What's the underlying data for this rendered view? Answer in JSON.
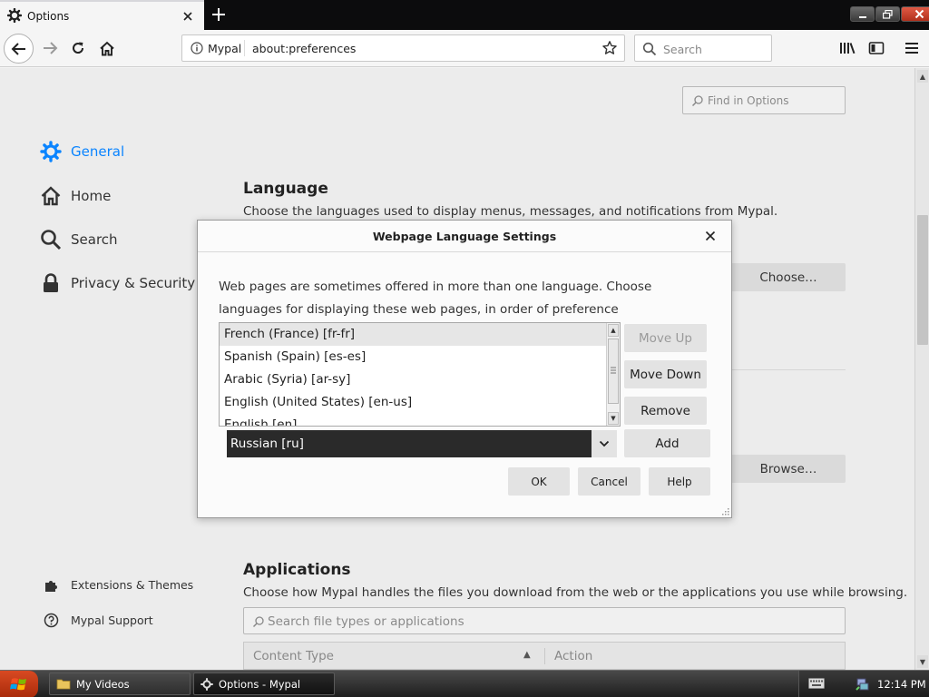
{
  "window": {
    "tab_title": "Options",
    "icons": [
      "gear-icon",
      "close-icon",
      "plus-icon"
    ]
  },
  "nav": {
    "identity": "Mypal",
    "url": "about:preferences",
    "search_placeholder": "Search"
  },
  "prefs": {
    "find_placeholder": "Find in Options",
    "categories": [
      {
        "label": "General",
        "icon": "gear-icon",
        "selected": true
      },
      {
        "label": "Home",
        "icon": "home-icon"
      },
      {
        "label": "Search",
        "icon": "search-icon"
      },
      {
        "label": "Privacy & Security",
        "icon": "lock-icon"
      }
    ],
    "footer": [
      {
        "label": "Extensions & Themes",
        "icon": "puzzle-icon"
      },
      {
        "label": "Mypal Support",
        "icon": "help-icon"
      }
    ],
    "language": {
      "title": "Language",
      "desc": "Choose the languages used to display menus, messages, and notifications from Mypal.",
      "choose_label": "Choose…"
    },
    "browse_label": "Browse…",
    "applications": {
      "title": "Applications",
      "desc": "Choose how Mypal handles the files you download from the web or the applications you use while browsing.",
      "search_placeholder": "Search file types or applications",
      "col_content_type": "Content Type",
      "col_action": "Action"
    }
  },
  "dialog": {
    "title": "Webpage Language Settings",
    "desc": "Web pages are sometimes offered in more than one language. Choose languages for displaying these web pages, in order of preference",
    "languages": [
      "French (France) [fr-fr]",
      "Spanish (Spain) [es-es]",
      "Arabic (Syria) [ar-sy]",
      "English (United States) [en-us]",
      "English [en]"
    ],
    "selected_language": "French (France) [fr-fr]",
    "move_up": "Move Up",
    "move_down": "Move Down",
    "remove": "Remove",
    "add_select_value": "Russian [ru]",
    "add": "Add",
    "ok": "OK",
    "cancel": "Cancel",
    "help": "Help"
  },
  "taskbar": {
    "items": [
      "My Videos",
      "Options - Mypal"
    ],
    "clock": "12:14 PM"
  },
  "colors": {
    "accent": "#0a84ff",
    "select_bg": "#2a2a2a",
    "start_button": "#c8401a"
  }
}
